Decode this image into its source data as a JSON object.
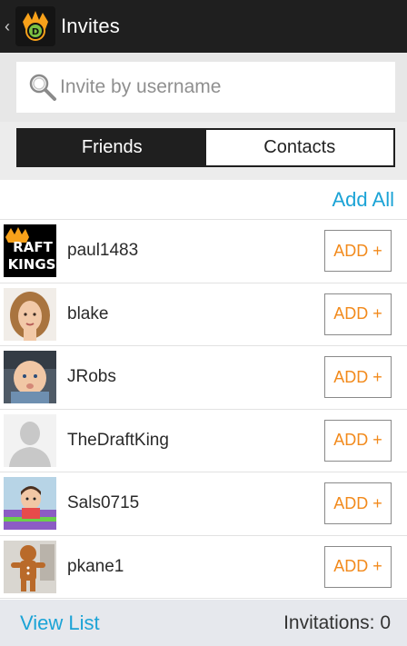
{
  "actionbar": {
    "title": "Invites",
    "back_glyph": "‹",
    "logo_icon": "draftkings-crown-icon"
  },
  "search": {
    "placeholder": "Invite by username",
    "icon": "search-icon"
  },
  "tabs": [
    {
      "label": "Friends",
      "active": true
    },
    {
      "label": "Contacts",
      "active": false
    }
  ],
  "list": {
    "add_all_label": "Add All",
    "rows": [
      {
        "username": "paul1483",
        "add_label": "ADD +",
        "avatar": "draftkings-logo-avatar"
      },
      {
        "username": "blake",
        "add_label": "ADD +",
        "avatar": "woman-photo-avatar"
      },
      {
        "username": "JRobs",
        "add_label": "ADD +",
        "avatar": "baby-photo-avatar"
      },
      {
        "username": "TheDraftKing",
        "add_label": "ADD +",
        "avatar": "default-silhouette-avatar"
      },
      {
        "username": "Sals0715",
        "add_label": "ADD +",
        "avatar": "child-photo-avatar"
      },
      {
        "username": "pkane1",
        "add_label": "ADD +",
        "avatar": "gingerbread-photo-avatar"
      }
    ]
  },
  "footer": {
    "view_list_label": "View List",
    "invitations_label": "Invitations: 0"
  },
  "colors": {
    "accent_blue": "#1ba3d6",
    "add_orange": "#f28a1c",
    "bar_dark": "#1f1f1f"
  }
}
